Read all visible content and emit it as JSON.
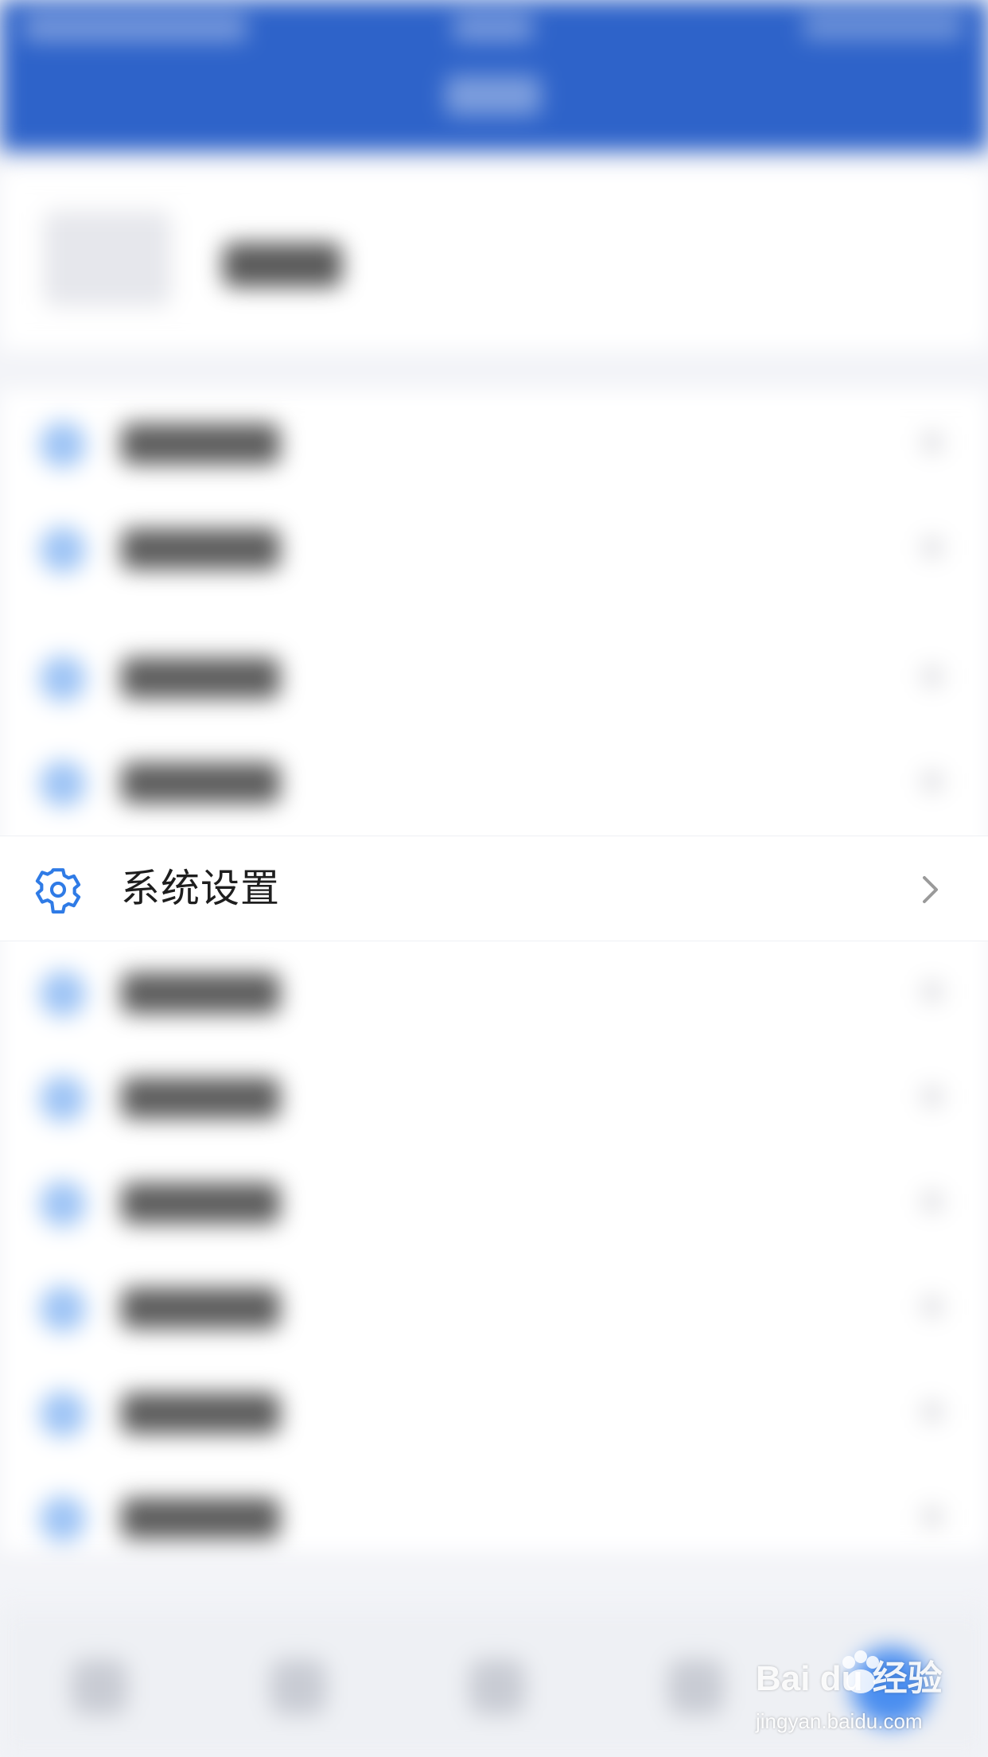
{
  "highlighted_item": {
    "label": "系统设置",
    "icon": "gear-icon",
    "accent_color": "#2f7be6"
  },
  "colors": {
    "header_blue": "#2e63c9",
    "page_bg": "#f3f4f8"
  },
  "watermark": {
    "brand": "Bai du 经验",
    "url": "jingyan.baidu.com"
  }
}
